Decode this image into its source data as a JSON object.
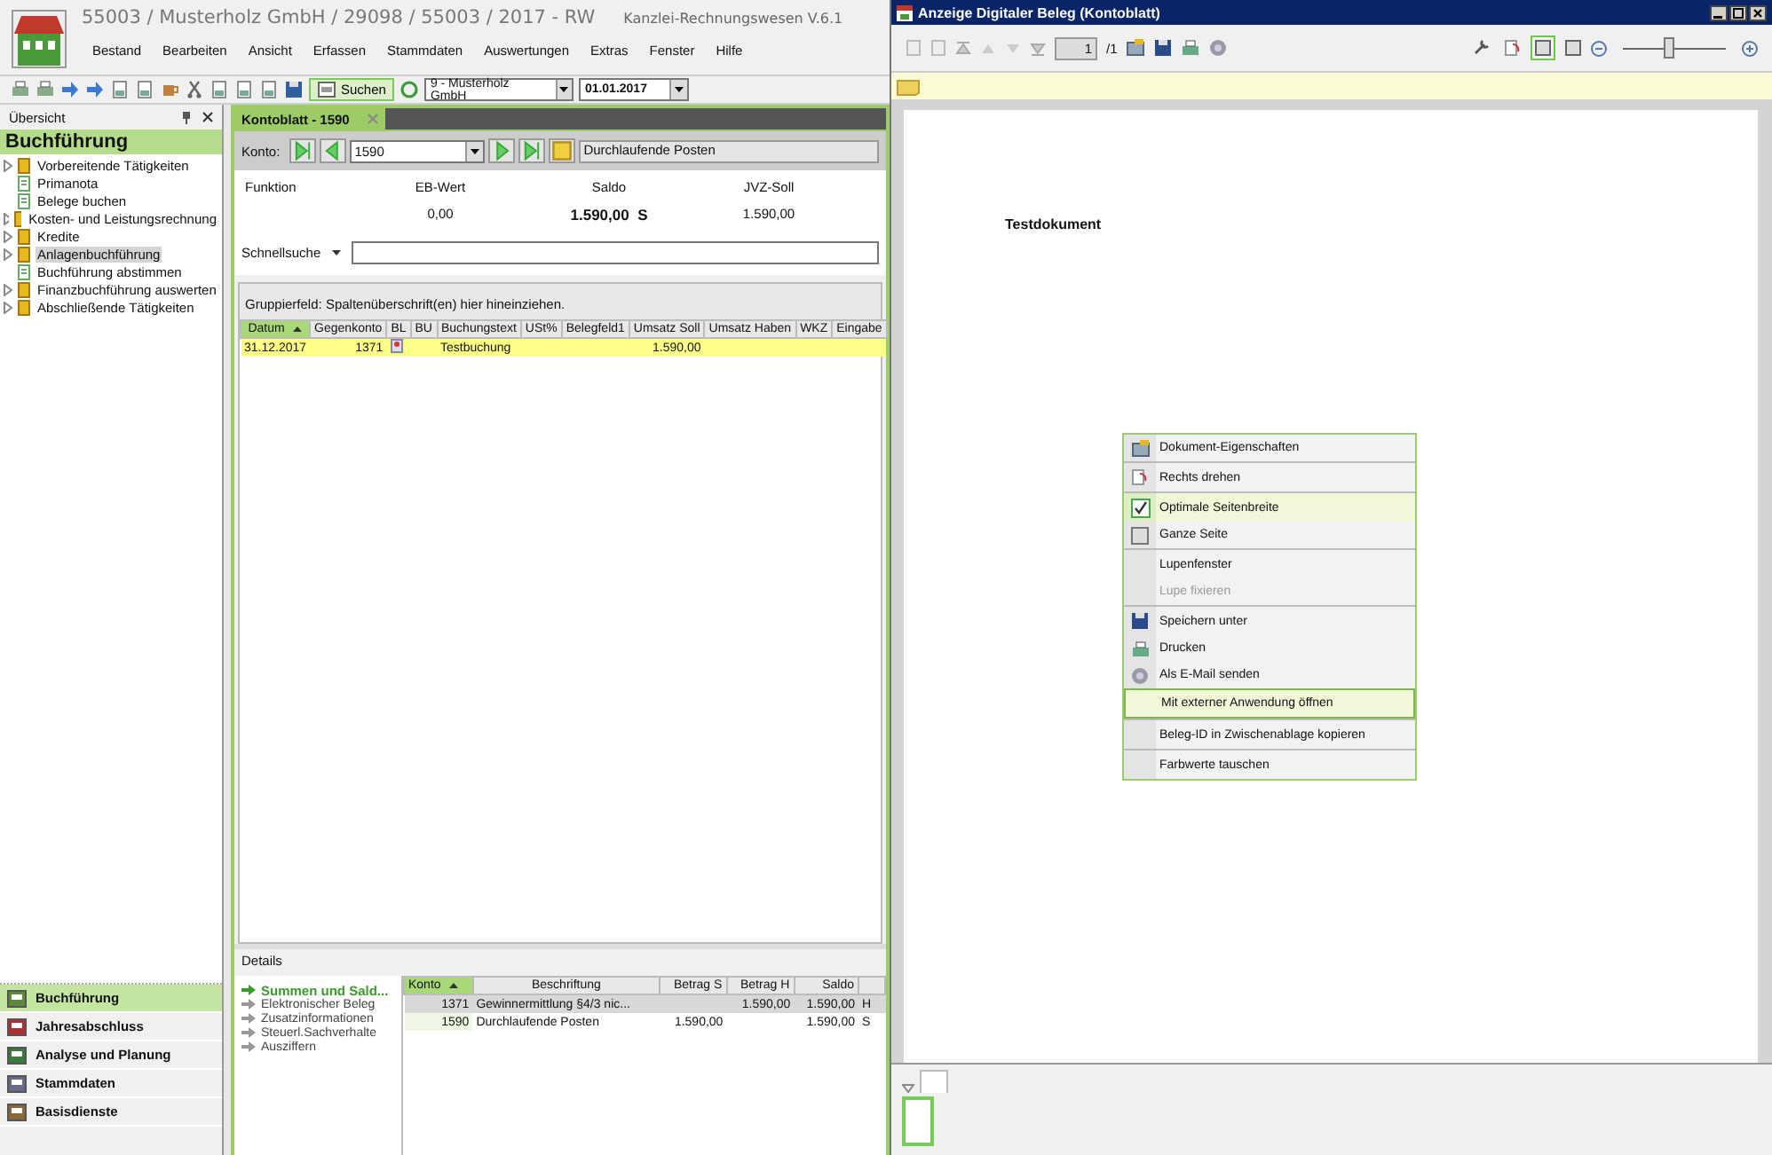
{
  "app": {
    "title": "55003 / Musterholz GmbH / 29098 / 55003 / 2017 - RW",
    "product": "Kanzlei-Rechnungswesen V.6.1",
    "menu": [
      "Bestand",
      "Bearbeiten",
      "Ansicht",
      "Erfassen",
      "Stammdaten",
      "Auswertungen",
      "Extras",
      "Fenster",
      "Hilfe"
    ]
  },
  "toolbar": {
    "search_button": "Suchen",
    "client_select": "9 - Musterholz GmbH",
    "date_field": "01.01.2017"
  },
  "overview": {
    "title": "Übersicht",
    "section": "Buchführung",
    "tree": [
      {
        "label": "Vorbereitende Tätigkeiten",
        "kind": "folder",
        "selected": false
      },
      {
        "label": "Primanota",
        "kind": "document",
        "selected": false
      },
      {
        "label": "Belege buchen",
        "kind": "document",
        "selected": false
      },
      {
        "label": "Kosten- und Leistungsrechnung",
        "kind": "folder",
        "selected": false
      },
      {
        "label": "Kredite",
        "kind": "folder",
        "selected": false
      },
      {
        "label": "Anlagenbuchführung",
        "kind": "folder",
        "selected": true
      },
      {
        "label": "Buchführung abstimmen",
        "kind": "document",
        "selected": false
      },
      {
        "label": "Finanzbuchführung auswerten",
        "kind": "folder",
        "selected": false
      },
      {
        "label": "Abschließende Tätigkeiten",
        "kind": "folder",
        "selected": false
      }
    ]
  },
  "nav": [
    {
      "label": "Buchführung",
      "selected": true
    },
    {
      "label": "Jahresabschluss",
      "selected": false
    },
    {
      "label": "Analyse und Planung",
      "selected": false
    },
    {
      "label": "Stammdaten",
      "selected": false
    },
    {
      "label": "Basisdienste",
      "selected": false
    }
  ],
  "tabs": [
    {
      "label": "Kontoblatt - 1590",
      "selected": true
    }
  ],
  "konto": {
    "label": "Konto:",
    "value": "1590",
    "name": "Durchlaufende Posten"
  },
  "summary": [
    {
      "label": "Funktion"
    },
    {
      "label": "EB-Wert",
      "value": "0,00"
    },
    {
      "label": "Saldo",
      "value": "1.590,00",
      "side": "S"
    },
    {
      "label": "JVZ-Soll",
      "value": "1.590,00"
    }
  ],
  "quick_search": {
    "label": "Schnellsuche"
  },
  "grid": {
    "group_hint": "Gruppierfeld: Spaltenüberschrift(en) hier hineinziehen.",
    "columns": [
      {
        "label": "Datum",
        "sorted": true
      },
      {
        "label": "Gegenkonto",
        "sorted": false
      },
      {
        "label": "BL",
        "sorted": false
      },
      {
        "label": "BU",
        "sorted": false
      },
      {
        "label": "Buchungstext",
        "sorted": false
      },
      {
        "label": "USt%",
        "sorted": false
      },
      {
        "label": "Belegfeld1",
        "sorted": false
      },
      {
        "label": "Umsatz Soll",
        "sorted": false
      },
      {
        "label": "Umsatz Haben",
        "sorted": false
      },
      {
        "label": "WKZ",
        "sorted": false
      },
      {
        "label": "Eingabe",
        "sorted": false
      }
    ],
    "rows": [
      {
        "cells": [
          {
            "text": "31.12.2017"
          },
          {
            "text": "1371"
          },
          {
            "kind": "attachment"
          },
          {},
          {
            "text": "Testbuchung"
          },
          {},
          {},
          {
            "text": "1.590,00"
          },
          {},
          {},
          {}
        ],
        "selected": true
      }
    ]
  },
  "details": {
    "title": "Details",
    "links": [
      {
        "label": "Summen und Sald...",
        "selected": true
      },
      {
        "label": "Elektronischer Beleg",
        "selected": false
      },
      {
        "label": "Zusatzinformationen",
        "selected": false
      },
      {
        "label": "Steuerl.Sachverhalte",
        "selected": false
      },
      {
        "label": "Ausziffern",
        "selected": false
      }
    ],
    "columns": [
      {
        "label": "Konto",
        "sorted": true
      },
      {
        "label": "Beschriftung",
        "sorted": false
      },
      {
        "label": "Betrag S",
        "sorted": false
      },
      {
        "label": "Betrag H",
        "sorted": false
      },
      {
        "label": "Saldo",
        "sorted": false
      }
    ],
    "rows": [
      {
        "konto": "1371",
        "beschriftung": "Gewinnermittlung §4/3 nic...",
        "betrag_h": "1.590,00",
        "saldo": "1.590,00",
        "side": "H",
        "selected": true
      },
      {
        "konto": "1590",
        "beschriftung": "Durchlaufende Posten",
        "betrag_s": "1.590,00",
        "saldo": "1.590,00",
        "side": "S",
        "selected": false
      }
    ]
  },
  "viewer": {
    "title": "Anzeige Digitaler Beleg (Kontoblatt)",
    "page_field": "1",
    "page_total": "/1",
    "zoom": {
      "level": 0.45
    },
    "document_text": "Testdokument",
    "context_menu": [
      {
        "label": "Dokument-Eigenschaften",
        "kind": "properties",
        "checked": false,
        "disabled": false,
        "hovered": false,
        "separator_before": false
      },
      {
        "label": "Rechts drehen",
        "kind": "rotate",
        "checked": false,
        "disabled": false,
        "hovered": false,
        "separator_before": true
      },
      {
        "label": "Optimale Seitenbreite",
        "kind": "option",
        "checked": true,
        "disabled": false,
        "hovered": false,
        "separator_before": true
      },
      {
        "label": "Ganze Seite",
        "kind": "option",
        "checked": false,
        "disabled": false,
        "hovered": false,
        "separator_before": false
      },
      {
        "label": "Lupenfenster",
        "kind": "plain",
        "checked": false,
        "disabled": false,
        "hovered": false,
        "separator_before": true
      },
      {
        "label": "Lupe fixieren",
        "kind": "plain",
        "checked": false,
        "disabled": true,
        "hovered": false,
        "separator_before": false
      },
      {
        "label": "Speichern unter",
        "kind": "save",
        "checked": false,
        "disabled": false,
        "hovered": false,
        "separator_before": true
      },
      {
        "label": "Drucken",
        "kind": "print",
        "checked": false,
        "disabled": false,
        "hovered": false,
        "separator_before": false
      },
      {
        "label": "Als E-Mail senden",
        "kind": "email",
        "checked": false,
        "disabled": false,
        "hovered": false,
        "separator_before": false
      },
      {
        "label": "Mit externer Anwendung öffnen",
        "kind": "plain",
        "checked": false,
        "disabled": false,
        "hovered": true,
        "separator_before": true
      },
      {
        "label": "Beleg-ID in Zwischenablage kopieren",
        "kind": "plain",
        "checked": false,
        "disabled": false,
        "hovered": false,
        "separator_before": true
      },
      {
        "label": "Farbwerte tauschen",
        "kind": "plain",
        "checked": false,
        "disabled": false,
        "hovered": false,
        "separator_before": true
      }
    ]
  }
}
